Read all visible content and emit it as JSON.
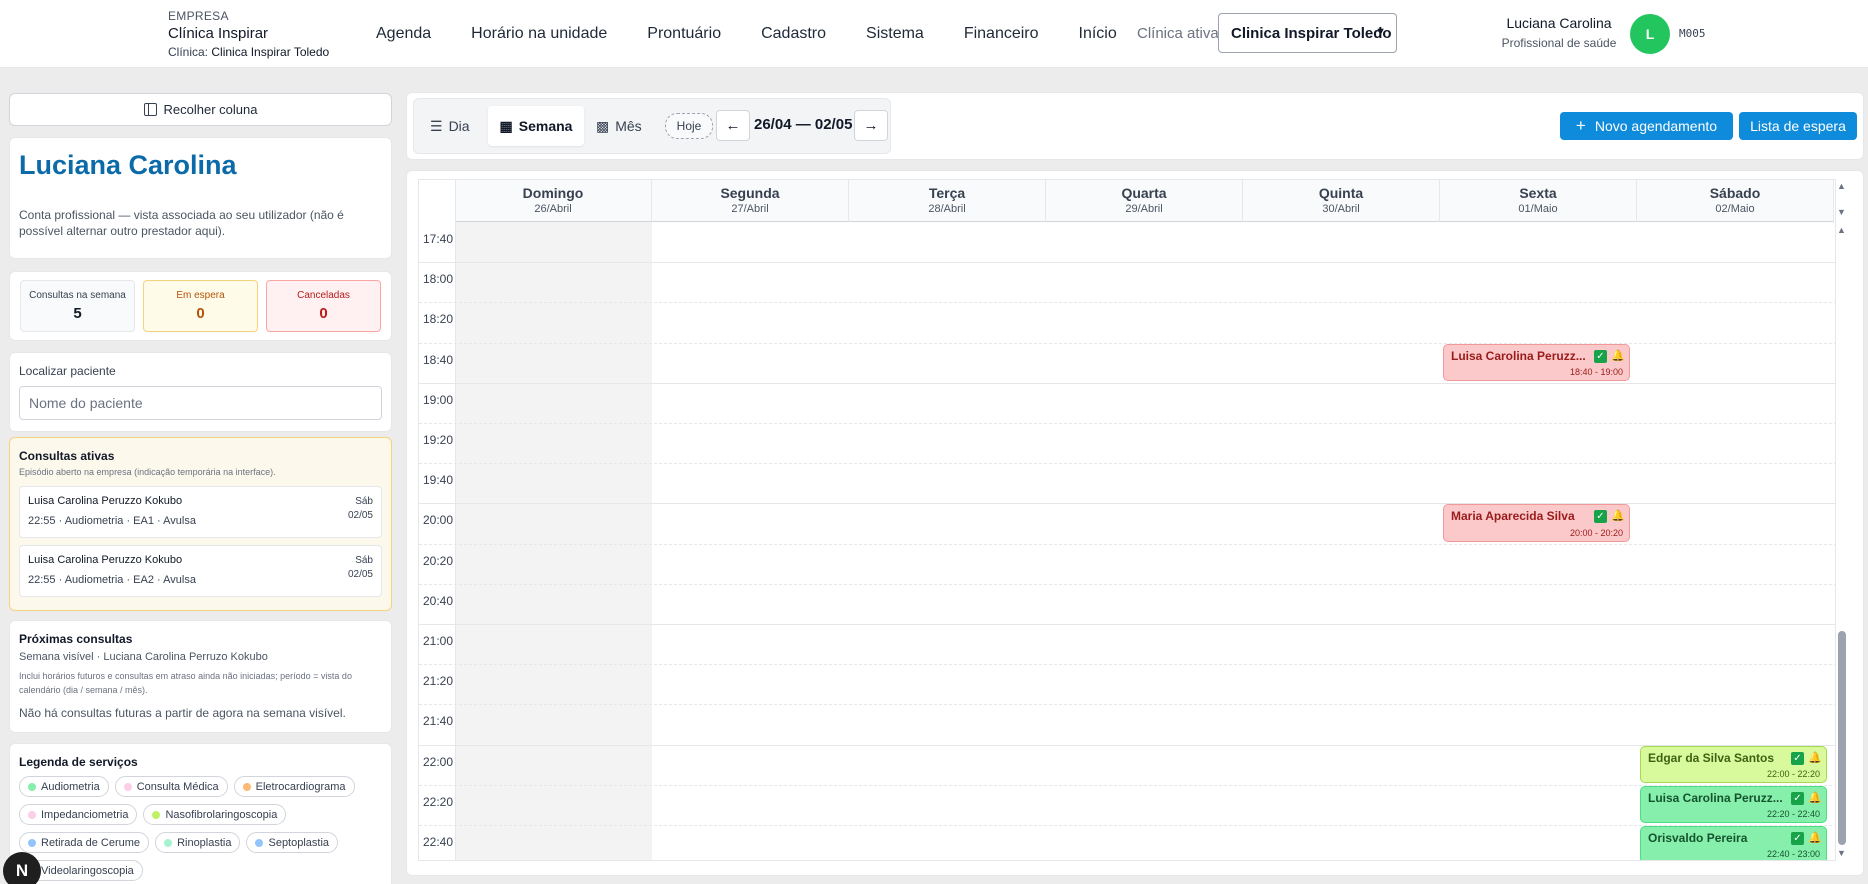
{
  "brand": {
    "company_label": "EMPRESA",
    "company_name": "Clínica Inspirar",
    "clinic_prefix": "Clínica:",
    "clinic_name": "Clinica Inspirar Toledo"
  },
  "nav": [
    "Agenda",
    "Horário na unidade",
    "Prontuário",
    "Cadastro",
    "Sistema",
    "Financeiro",
    "Início"
  ],
  "header": {
    "active_clinic_label": "Clínica ativa",
    "active_clinic_value": "Clinica Inspirar Toledo",
    "user_name": "Luciana Carolina",
    "user_role": "Profissional de saúde",
    "avatar_letter": "L",
    "user_code": "M005"
  },
  "sidebar": {
    "collapse_label": "Recolher coluna",
    "professional_name": "Luciana Carolina",
    "professional_desc": "Conta profissional — vista associada ao seu utilizador (não é possível alternar outro prestador aqui).",
    "stats": [
      {
        "label": "Consultas na semana",
        "value": "5"
      },
      {
        "label": "Em espera",
        "value": "0"
      },
      {
        "label": "Canceladas",
        "value": "0"
      }
    ],
    "search": {
      "title": "Localizar paciente",
      "placeholder": "Nome do paciente"
    },
    "active": {
      "title": "Consultas ativas",
      "subtitle": "Episódio aberto na empresa (indicação temporária na interface).",
      "items": [
        {
          "patient": "Luisa Carolina Peruzzo Kokubo",
          "detail": "22:55 · Audiometria · EA1 · Avulsa",
          "weekday": "Sáb",
          "date": "02/05"
        },
        {
          "patient": "Luisa Carolina Peruzzo Kokubo",
          "detail": "22:55 · Audiometria · EA2 · Avulsa",
          "weekday": "Sáb",
          "date": "02/05"
        }
      ]
    },
    "next": {
      "title": "Próximas consultas",
      "sub1": "Semana visível · Luciana Carolina Perruzo Kokubo",
      "sub2": "Inclui horários futuros e consultas em atraso ainda não iniciadas; período = vista do calendário (dia / semana / mês).",
      "empty": "Não há consultas futuras a partir de agora na semana visível."
    },
    "legend": {
      "title": "Legenda de serviços",
      "items": [
        {
          "label": "Audiometria",
          "color": "#86efac"
        },
        {
          "label": "Consulta Médica",
          "color": "#fbcfe8"
        },
        {
          "label": "Eletrocardiograma",
          "color": "#fdba74"
        },
        {
          "label": "Impedanciometria",
          "color": "#fbcfe8"
        },
        {
          "label": "Nasofibrolaringoscopia",
          "color": "#bef264"
        },
        {
          "label": "Retirada de Cerume",
          "color": "#93c5fd"
        },
        {
          "label": "Rinoplastia",
          "color": "#a7f3d0"
        },
        {
          "label": "Septoplastia",
          "color": "#93c5fd"
        },
        {
          "label": "Videolaringoscopia",
          "color": "#fbcfe8"
        }
      ]
    }
  },
  "toolbar": {
    "view_day": "Dia",
    "view_week": "Semana",
    "view_month": "Mês",
    "today": "Hoje",
    "prev": "←",
    "next": "→",
    "range": "26/04 — 02/05",
    "new_btn": "Novo agendamento",
    "waitlist_btn": "Lista de espera"
  },
  "calendar": {
    "days": [
      {
        "name": "Domingo",
        "date": "26/Abril"
      },
      {
        "name": "Segunda",
        "date": "27/Abril"
      },
      {
        "name": "Terça",
        "date": "28/Abril"
      },
      {
        "name": "Quarta",
        "date": "29/Abril"
      },
      {
        "name": "Quinta",
        "date": "30/Abril"
      },
      {
        "name": "Sexta",
        "date": "01/Maio"
      },
      {
        "name": "Sábado",
        "date": "02/Maio"
      }
    ],
    "times": [
      "17:40",
      "18:00",
      "18:20",
      "18:40",
      "19:00",
      "19:20",
      "19:40",
      "20:00",
      "20:20",
      "20:40",
      "21:00",
      "21:20",
      "21:40",
      "22:00",
      "22:20",
      "22:40"
    ],
    "events": [
      {
        "name": "Luisa Carolina Peruzz...",
        "time": "18:40 - 19:00",
        "day": "Sexta",
        "start": "18:40",
        "color_class": "red"
      },
      {
        "name": "Maria Aparecida Silva",
        "time": "20:00 - 20:20",
        "day": "Sexta",
        "start": "20:00",
        "color_class": "red"
      },
      {
        "name": "Edgar da Silva Santos",
        "time": "22:00 - 22:20",
        "day": "Sábado",
        "start": "22:00",
        "color_class": "lime"
      },
      {
        "name": "Luisa Carolina Peruzz...",
        "time": "22:20 - 22:40",
        "day": "Sábado",
        "start": "22:20",
        "color_class": "green"
      },
      {
        "name": "Orisvaldo Pereira",
        "time": "22:40 - 23:00",
        "day": "Sábado",
        "start": "22:40",
        "color_class": "green"
      }
    ]
  }
}
